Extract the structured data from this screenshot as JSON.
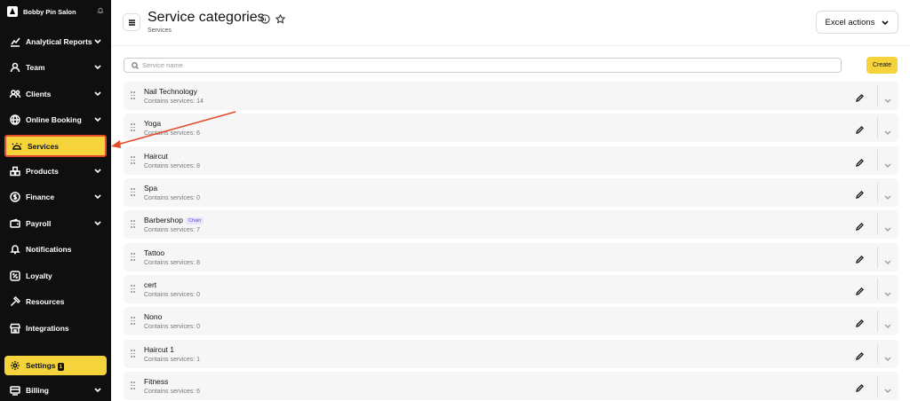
{
  "sidebar": {
    "brand": "Bobby Pin Salon",
    "items": [
      {
        "label": "Analytical Reports",
        "icon": "chart-icon",
        "has_chevron": true
      },
      {
        "label": "Team",
        "icon": "user-icon",
        "has_chevron": true
      },
      {
        "label": "Clients",
        "icon": "users-icon",
        "has_chevron": true
      },
      {
        "label": "Online Booking",
        "icon": "globe-icon",
        "has_chevron": true
      },
      {
        "label": "Services",
        "icon": "cloche-icon",
        "active": true
      },
      {
        "label": "Products",
        "icon": "boxes-icon",
        "has_chevron": true
      },
      {
        "label": "Finance",
        "icon": "dollar-icon",
        "has_chevron": true
      },
      {
        "label": "Payroll",
        "icon": "wallet-icon",
        "has_chevron": true
      },
      {
        "label": "Notifications",
        "icon": "bell-icon"
      },
      {
        "label": "Loyalty",
        "icon": "percent-icon"
      },
      {
        "label": "Resources",
        "icon": "hammer-icon"
      },
      {
        "label": "Integrations",
        "icon": "store-icon"
      }
    ],
    "settings": {
      "label": "Settings",
      "badge": "1"
    },
    "billing": {
      "label": "Billing"
    }
  },
  "header": {
    "title": "Service categories",
    "subtitle": "Services",
    "excel_label": "Excel actions"
  },
  "search": {
    "placeholder": "Service name"
  },
  "create_label": "Create",
  "categories": [
    {
      "name": "Nail Technology",
      "count": "Contains services: 14"
    },
    {
      "name": "Yoga",
      "count": "Contains services: 6"
    },
    {
      "name": "Haircut",
      "count": "Contains services: 8"
    },
    {
      "name": "Spa",
      "count": "Contains services: 0"
    },
    {
      "name": "Barbershop",
      "count": "Contains services: 7",
      "tag": "Chain"
    },
    {
      "name": "Tattoo",
      "count": "Contains services: 8"
    },
    {
      "name": "cert",
      "count": "Contains services: 0"
    },
    {
      "name": "Nono",
      "count": "Contains services: 0"
    },
    {
      "name": "Haircut 1",
      "count": "Contains services: 1"
    },
    {
      "name": "Fitness",
      "count": "Contains services: 6"
    }
  ],
  "colors": {
    "accent": "#f5d33b",
    "sidebar_bg": "#0f0f0f",
    "annotation": "#e34b2b"
  }
}
